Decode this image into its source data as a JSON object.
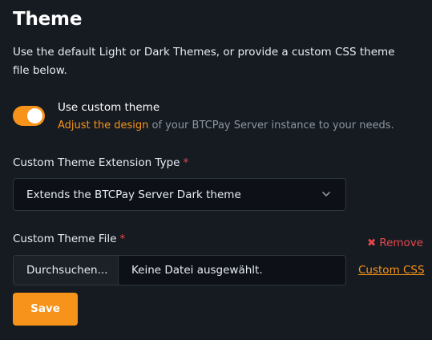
{
  "section": {
    "title": "Theme",
    "description": "Use the default Light or Dark Themes, or provide a custom CSS theme file below."
  },
  "custom_theme_toggle": {
    "label": "Use custom theme",
    "enabled": true,
    "help_link": "Adjust the design",
    "help_rest": " of your BTCPay Server instance to your needs."
  },
  "extension_type": {
    "label": "Custom Theme Extension Type",
    "required_mark": "*",
    "selected": "Extends the BTCPay Server Dark theme"
  },
  "theme_file": {
    "label": "Custom Theme File",
    "required_mark": "*",
    "remove_label": "Remove",
    "browse_label": "Durchsuchen...",
    "no_file_text": "Keine Datei ausgewählt.",
    "custom_css_link": "Custom CSS"
  },
  "actions": {
    "save_label": "Save"
  },
  "colors": {
    "background": "#161b22",
    "accent": "#f7931a",
    "danger": "#e5484d",
    "muted": "#8b949e"
  },
  "icons": {
    "select_chevron": "chevron-down-icon",
    "remove": "x-icon"
  }
}
